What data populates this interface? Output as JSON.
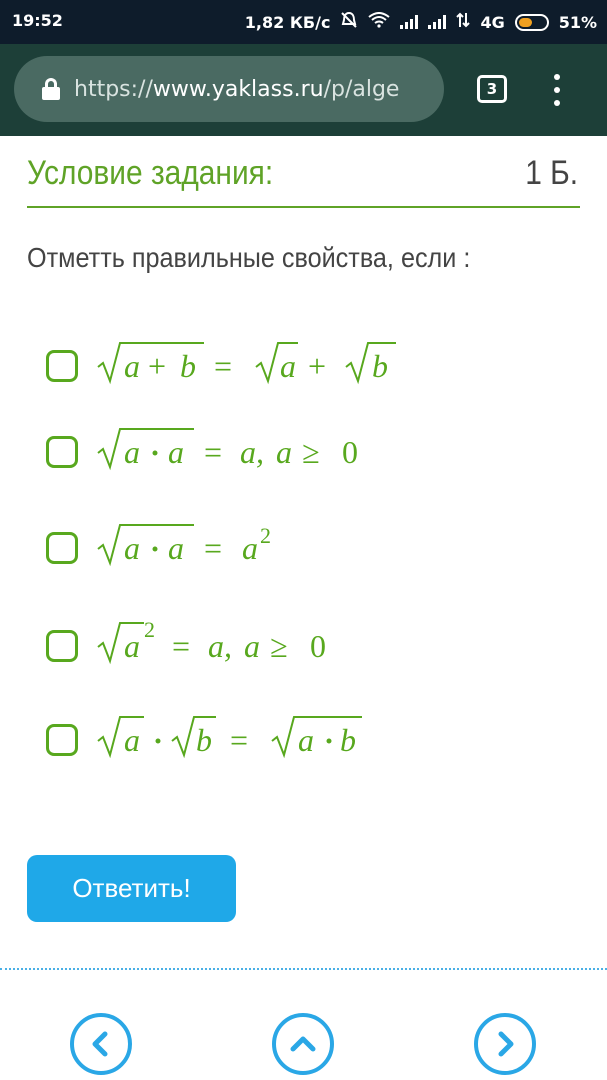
{
  "status_bar": {
    "time": "19:52",
    "speed": "1,82 КБ/с",
    "network": "4G",
    "battery": "51%",
    "battery_level": 0.51,
    "icons": [
      "mute-icon",
      "wifi-icon",
      "signal-icon",
      "signal-icon",
      "data-arrows-icon",
      "battery-icon"
    ]
  },
  "browser": {
    "url_scheme": "https://",
    "url_host": "www.yaklass.ru",
    "url_path": "/p/alge",
    "tab_count": "3"
  },
  "task": {
    "title": "Условие задания:",
    "points": "1 Б.",
    "question": "Отметть правильные свойства, если :"
  },
  "options": [
    {
      "id": "opt1",
      "checked": false,
      "formula_text": "√(a+b) = √a + √b"
    },
    {
      "id": "opt2",
      "checked": false,
      "formula_text": "√(a·a) = a, a ≥ 0"
    },
    {
      "id": "opt3",
      "checked": false,
      "formula_text": "√(a·a) = a²"
    },
    {
      "id": "opt4",
      "checked": false,
      "formula_text": "√a² = a, a ≥ 0"
    },
    {
      "id": "opt5",
      "checked": false,
      "formula_text": "√a · √b = √(a·b)"
    }
  ],
  "answer_button": "Ответить!",
  "colors": {
    "accent_green": "#58a81e",
    "button_blue": "#1fa8e8",
    "browser_bar": "#1d3f38"
  },
  "nav": [
    "chevron-left-icon",
    "chevron-up-icon",
    "chevron-right-icon"
  ]
}
